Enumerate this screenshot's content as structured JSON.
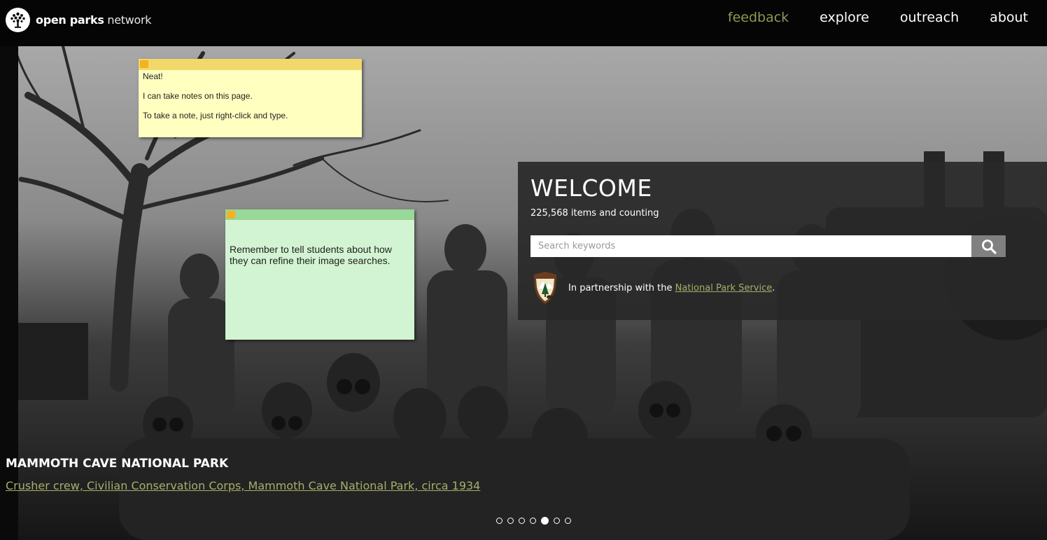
{
  "brand": {
    "name_bold": "open parks",
    "name_light": "network",
    "logo_icon": "tree-icon"
  },
  "nav": {
    "items": [
      {
        "label": "feedback",
        "active": true
      },
      {
        "label": "explore",
        "active": false
      },
      {
        "label": "outreach",
        "active": false
      },
      {
        "label": "about",
        "active": false
      }
    ]
  },
  "welcome": {
    "title": "WELCOME",
    "counter": "225,568 items and counting",
    "search_placeholder": "Search keywords",
    "search_icon": "search-icon",
    "partner_prefix": "In partnership with the",
    "partner_link": "National Park Service",
    "partner_suffix": "."
  },
  "caption": {
    "title": "MAMMOTH CAVE NATIONAL PARK",
    "link": "Crusher crew, Civilian Conservation Corps, Mammoth Cave National Park, circa 1934"
  },
  "carousel": {
    "count": 7,
    "active_index": 4
  },
  "notes": {
    "yellow": {
      "lines": [
        "Neat!",
        "I can take notes on this page.",
        "To take a note, just right-click and type."
      ]
    },
    "green": {
      "text": "Remember to tell students about how they can refine their image searches."
    }
  },
  "colors": {
    "accent": "#a7ad6a",
    "nav_active": "#8f9a52",
    "note_yellow": "#ffffc0",
    "note_green": "#d2f4d2"
  }
}
